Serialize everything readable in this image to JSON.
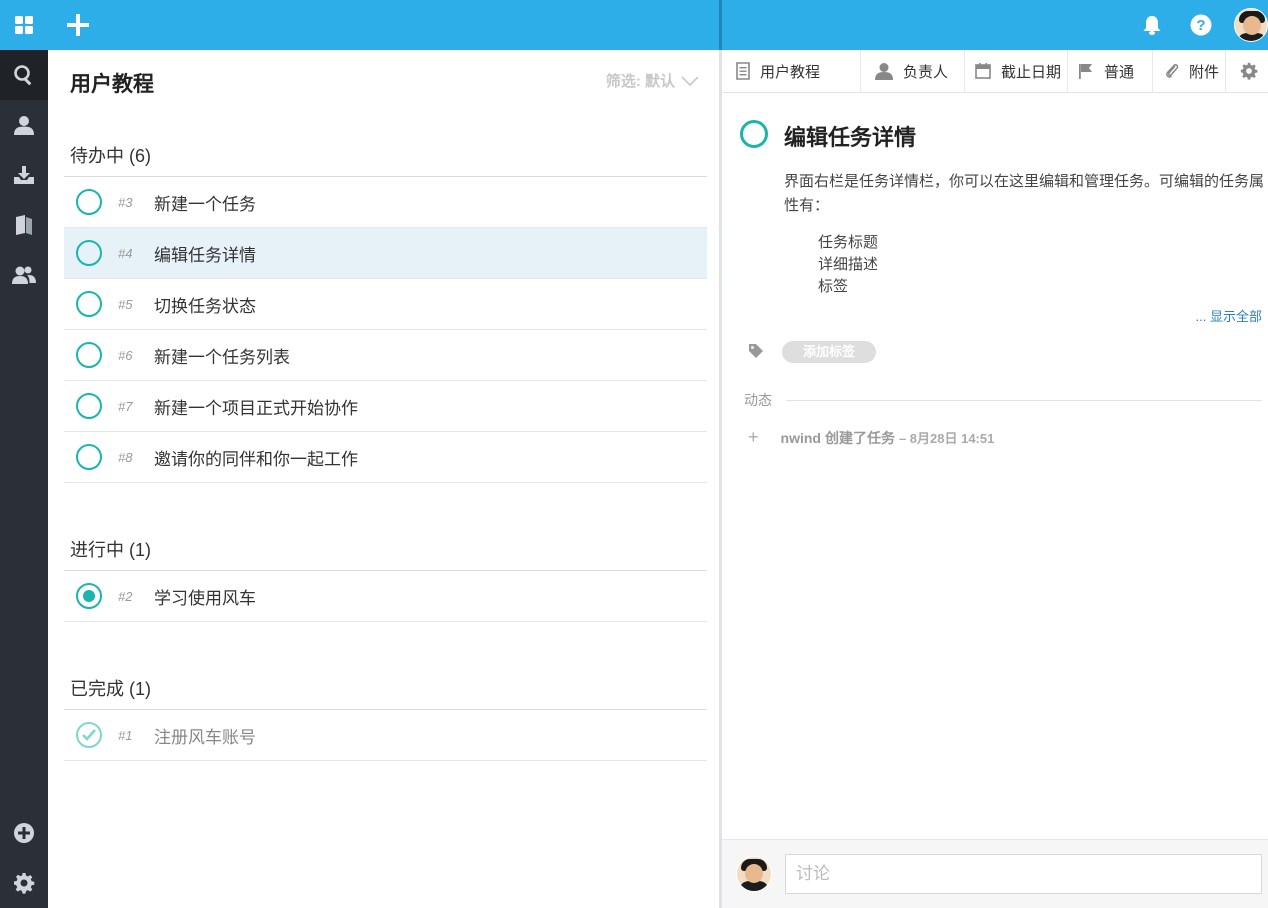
{
  "app": {
    "list_title": "用户教程",
    "filter_label": "筛选: 默认"
  },
  "rail": {
    "items": [
      "apps-icon",
      "search-icon",
      "user-icon",
      "inbox-icon",
      "book-icon",
      "team-icon"
    ],
    "bottom": [
      "add-circle-icon",
      "gear-icon"
    ]
  },
  "sections": [
    {
      "title": "待办中 (6)",
      "tasks": [
        {
          "num": "#3",
          "name": "新建一个任务",
          "status": "todo"
        },
        {
          "num": "#4",
          "name": "编辑任务详情",
          "status": "todo",
          "selected": true
        },
        {
          "num": "#5",
          "name": "切换任务状态",
          "status": "todo"
        },
        {
          "num": "#6",
          "name": "新建一个任务列表",
          "status": "todo"
        },
        {
          "num": "#7",
          "name": "新建一个项目正式开始协作",
          "status": "todo"
        },
        {
          "num": "#8",
          "name": "邀请你的同伴和你一起工作",
          "status": "todo"
        }
      ]
    },
    {
      "title": "进行中 (1)",
      "tasks": [
        {
          "num": "#2",
          "name": "学习使用风车",
          "status": "inprogress"
        }
      ]
    },
    {
      "title": "已完成 (1)",
      "tasks": [
        {
          "num": "#1",
          "name": "注册风车账号",
          "status": "done"
        }
      ]
    }
  ],
  "detail": {
    "toolbar": {
      "project": "用户教程",
      "assignee": "负责人",
      "due_date": "截止日期",
      "priority": "普通",
      "attachments": "附件"
    },
    "title": "编辑任务详情",
    "description": "界面右栏是任务详情栏，你可以在这里编辑和管理任务。可编辑的任务属性有：",
    "bullets": [
      "任务标题",
      "详细描述",
      "标签"
    ],
    "show_all": "... 显示全部",
    "add_tag": "添加标签",
    "activity_label": "动态",
    "activity": {
      "user": "nwind",
      "action": "创建了任务",
      "time": "– 8月28日 14:51"
    },
    "comment_placeholder": "讨论"
  },
  "colors": {
    "header_blue": "#2eaee8",
    "teal": "#1ab5ad",
    "rail_dark": "#2b3036",
    "selected_row": "#e7f2f8",
    "link_blue": "#2b7fc2"
  }
}
